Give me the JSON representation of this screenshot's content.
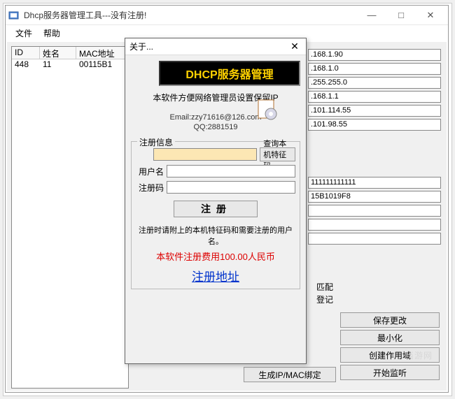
{
  "window": {
    "title": "Dhcp服务器管理工具---没有注册!",
    "controls": {
      "min": "—",
      "max": "□",
      "close": "✕"
    }
  },
  "menubar": [
    "文件",
    "帮助"
  ],
  "table": {
    "headers": [
      "ID",
      "姓名",
      "MAC地址"
    ],
    "rows": [
      {
        "id": "448",
        "name": "11",
        "mac": "00115B1"
      }
    ]
  },
  "right_fields_top": [
    ".168.1.90",
    ".168.1.0",
    ".255.255.0",
    ".168.1.1",
    ".101.114.55",
    ".101.98.55"
  ],
  "right_fields_mid": [
    "111111111111",
    "15B1019F8"
  ],
  "partial_labels": {
    "a": "匹配",
    "b": "登记"
  },
  "buttons": {
    "genip": "生成IP/MAC绑定",
    "save": "保存更改",
    "min": "最小化",
    "scope": "创建作用域",
    "start": "开始监听"
  },
  "dialog": {
    "title": "关于...",
    "close": "✕",
    "banner": "DHCP服务器管理",
    "desc": "本软件方便网络管理员设置保留IP",
    "email": "Email:zzy71616@126.com",
    "qq": "QQ:2881519",
    "group_legend": "注册信息",
    "query_btn": "查询本机特征码",
    "user_label": "用户名",
    "code_label": "注册码",
    "reg_btn": "注册",
    "note": "注册时请附上的本机特征码和需要注册的用户名。",
    "fee": "本软件注册费用100.00人民币",
    "link": "注册地址"
  },
  "watermark": "当游网"
}
